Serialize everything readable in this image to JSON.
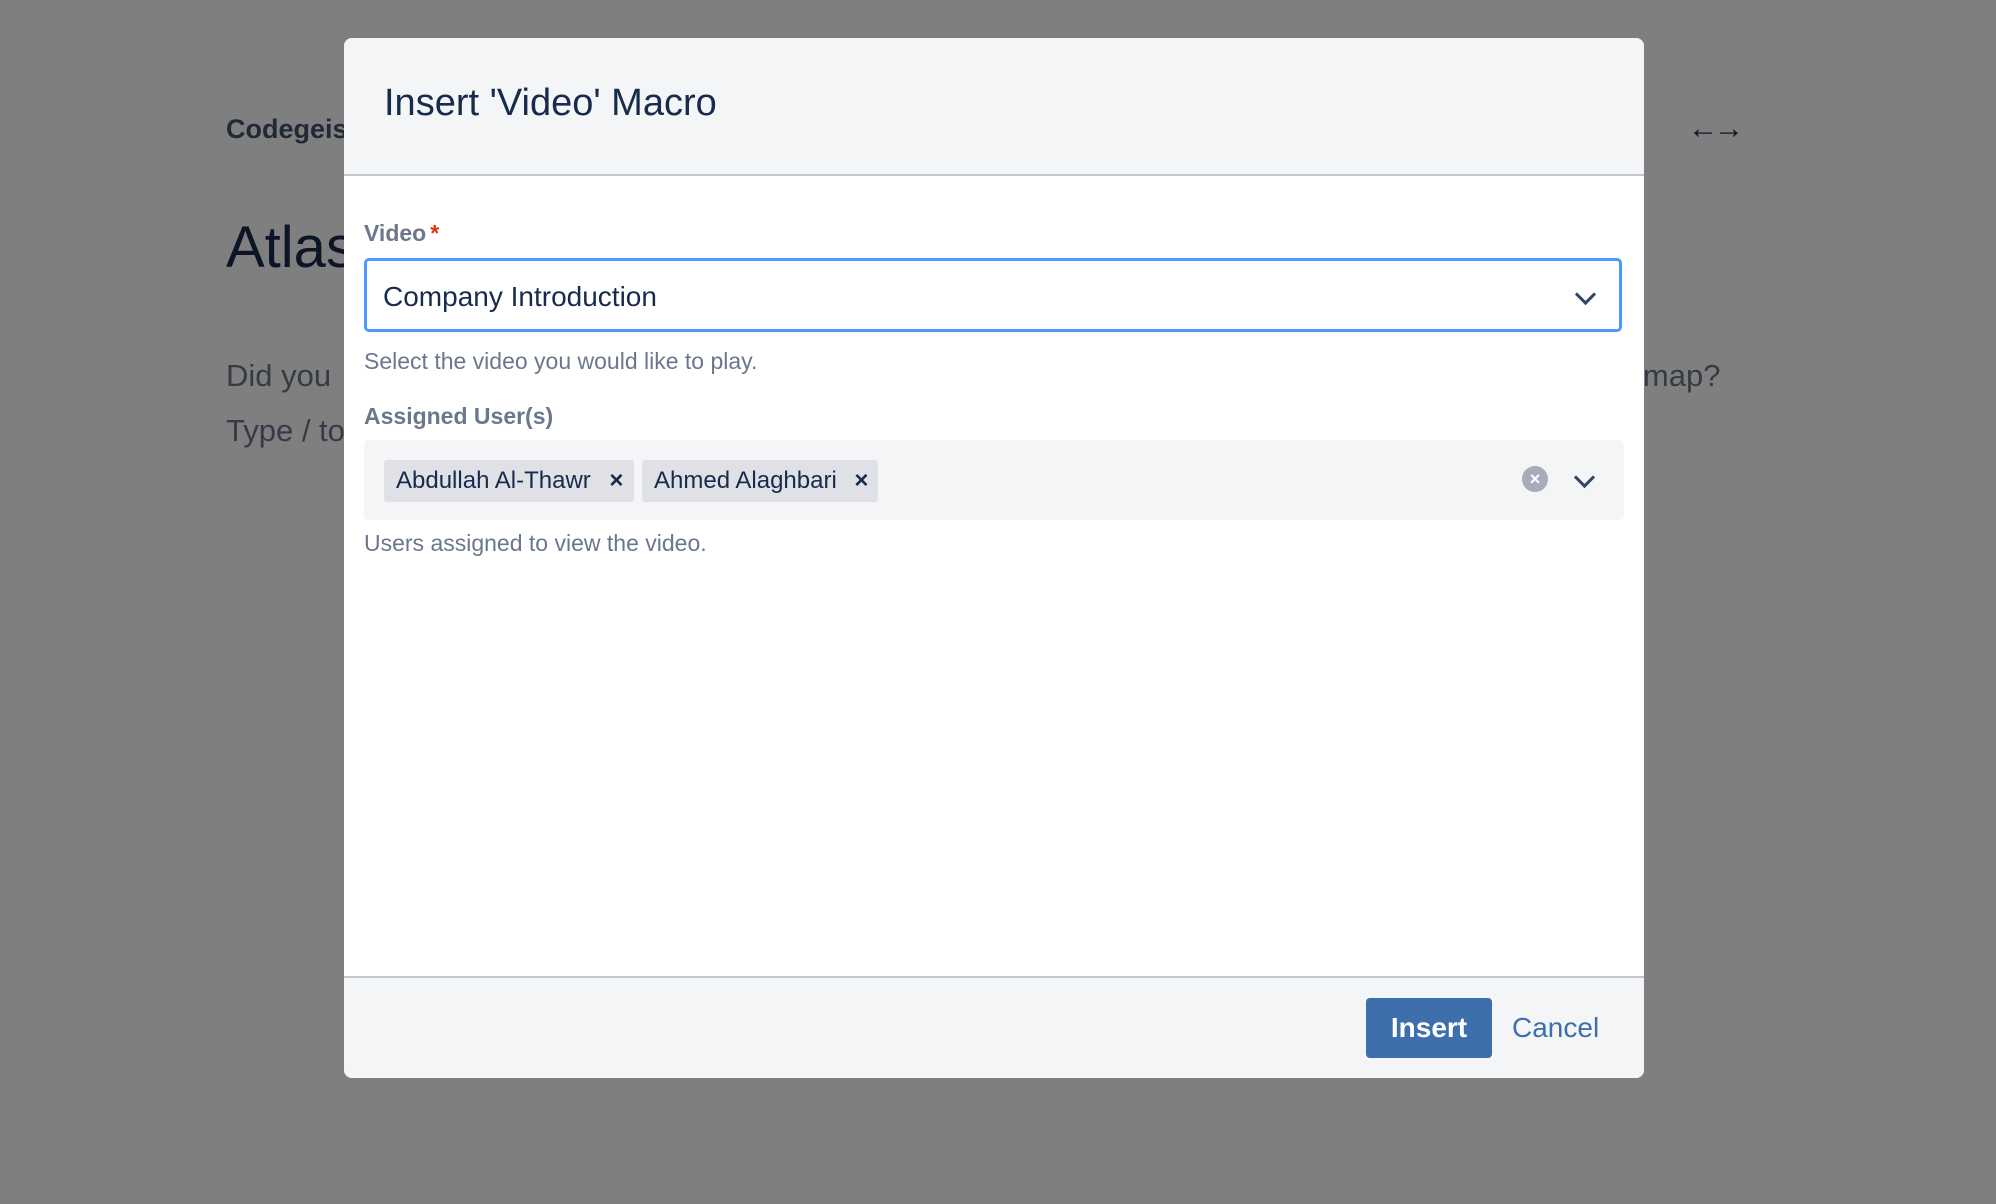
{
  "background": {
    "breadcrumb": "Codegeis",
    "page_title": "Atlas",
    "paragraph_lines_left": [
      "Did you",
      "Type / to"
    ],
    "paragraph_right": "lmap?",
    "width_toggle_icon": "arrows-horizontal-icon"
  },
  "dialog": {
    "title": "Insert 'Video' Macro",
    "video_field": {
      "label": "Video",
      "required_marker": "*",
      "value": "Company Introduction",
      "help": "Select the video you would like to play."
    },
    "users_field": {
      "label": "Assigned User(s)",
      "tags": [
        {
          "label": "Abdullah Al-Thawr",
          "remove": "×"
        },
        {
          "label": "Ahmed Alaghbari",
          "remove": "×"
        }
      ],
      "clear_glyph": "×",
      "help": "Users assigned to view the video."
    },
    "footer": {
      "insert_label": "Insert",
      "cancel_label": "Cancel"
    }
  },
  "colors": {
    "accent": "#3e6fad",
    "focus_border": "#4c9aff",
    "required": "#de350b",
    "overlay": "rgba(0,0,0,0.5)"
  }
}
